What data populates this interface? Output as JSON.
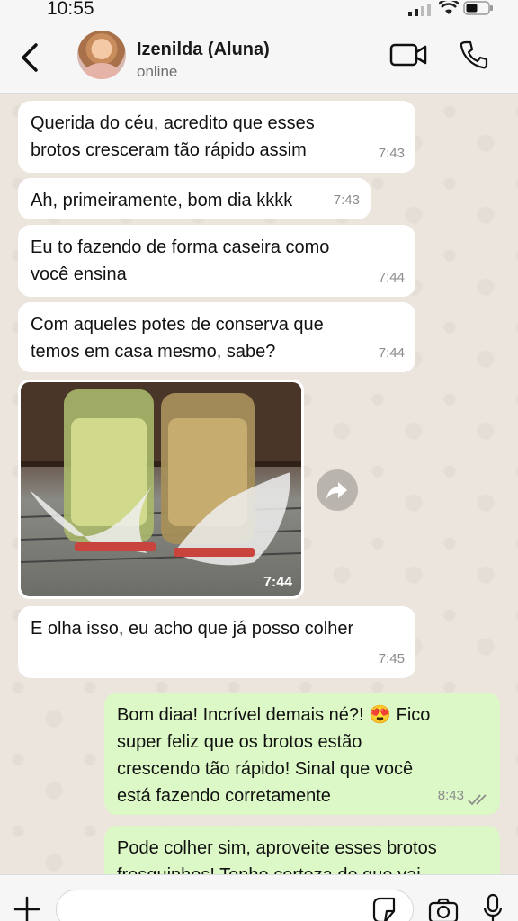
{
  "status_bar": {
    "time": "10:55"
  },
  "header": {
    "contact_name": "Izenilda (Aluna)",
    "contact_status": "online"
  },
  "messages": [
    {
      "direction": "incoming",
      "lines": [
        "Querida do céu, acredito que esses",
        "brotos cresceram tão rápido assim"
      ],
      "time": "7:43"
    },
    {
      "direction": "incoming",
      "lines": [
        "Ah, primeiramente, bom dia kkkk"
      ],
      "time": "7:43"
    },
    {
      "direction": "incoming",
      "lines": [
        "Eu to fazendo de forma caseira como",
        "você ensina"
      ],
      "time": "7:44"
    },
    {
      "direction": "incoming",
      "lines": [
        "Com aqueles potes de conserva que",
        "temos em casa mesmo, sabe?"
      ],
      "time": "7:44"
    },
    {
      "direction": "incoming",
      "type": "image",
      "time": "7:44"
    },
    {
      "direction": "incoming",
      "lines": [
        "E olha isso, eu acho que já posso colher"
      ],
      "time": "7:45"
    },
    {
      "direction": "outgoing",
      "lines": [
        "Bom diaa! Incrível demais né?! 😍 Fico",
        "super feliz que os brotos estão",
        "crescendo tão rápido! Sinal que você",
        "está fazendo corretamente"
      ],
      "time": "8:43",
      "status": "read"
    },
    {
      "direction": "outgoing",
      "lines": [
        "Pode colher sim, aproveite esses brotos",
        "fresquinhos! Tenho certeza de que vai"
      ],
      "time": ""
    }
  ],
  "composer": {
    "placeholder": ""
  },
  "colors": {
    "incoming": "#ffffff",
    "outgoing": "#dcf8c6",
    "read_ticks": "#8c8c8c"
  }
}
